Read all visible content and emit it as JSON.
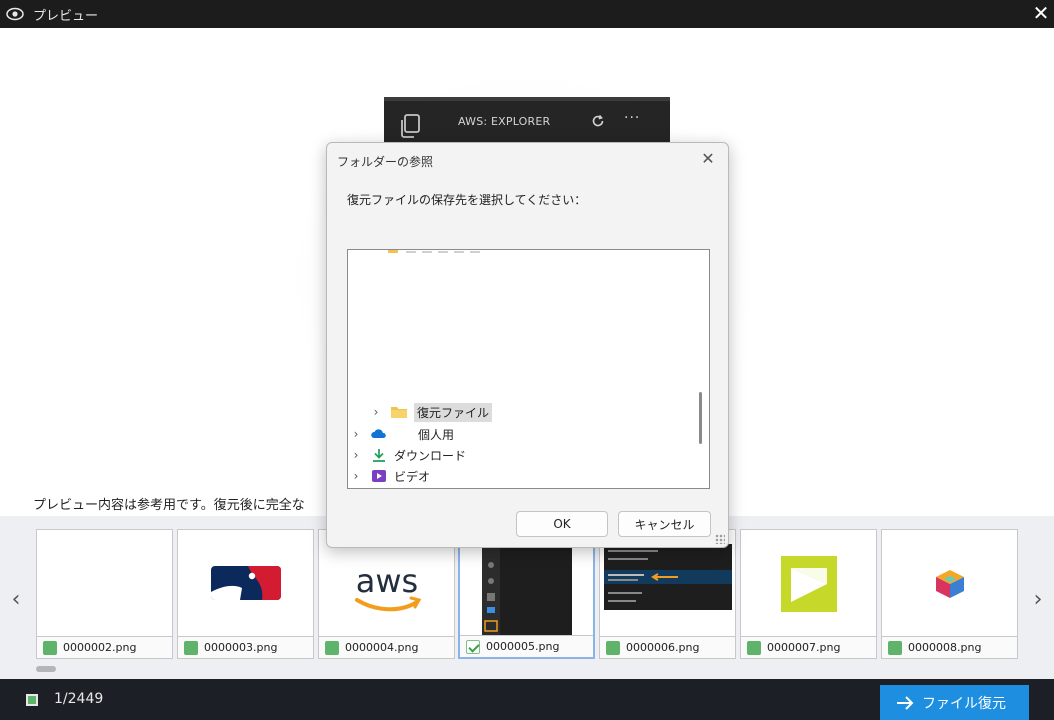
{
  "window": {
    "title": "プレビュー"
  },
  "preview": {
    "explorer_title": "AWS: EXPLORER",
    "more_label": "···",
    "notice": "プレビュー内容は参考用です。復元後に完全な"
  },
  "dialog": {
    "title": "フォルダーの参照",
    "prompt": "復元ファイルの保存先を選択してください：",
    "tree": [
      {
        "label": "復元ファイル",
        "icon": "folder-icon",
        "selected": true
      },
      {
        "label": "個人用",
        "icon": "onedrive-cloud-icon",
        "selected": false
      },
      {
        "label": "ダウンロード",
        "icon": "download-icon",
        "selected": false
      },
      {
        "label": "ビデオ",
        "icon": "video-icon",
        "selected": false
      }
    ],
    "ok_label": "OK",
    "cancel_label": "キャンセル"
  },
  "thumbnails": [
    {
      "filename": "0000002.png",
      "checked": false
    },
    {
      "filename": "0000003.png",
      "checked": false
    },
    {
      "filename": "0000004.png",
      "checked": false
    },
    {
      "filename": "0000005.png",
      "checked": true
    },
    {
      "filename": "0000006.png",
      "checked": false
    },
    {
      "filename": "0000007.png",
      "checked": false
    },
    {
      "filename": "0000008.png",
      "checked": false
    }
  ],
  "footer": {
    "count": "1/2449",
    "restore_label": "ファイル復元"
  },
  "colors": {
    "accent": "#1e8fe0",
    "check_green": "#5fb36a",
    "titlebar": "#1c1c1c"
  }
}
